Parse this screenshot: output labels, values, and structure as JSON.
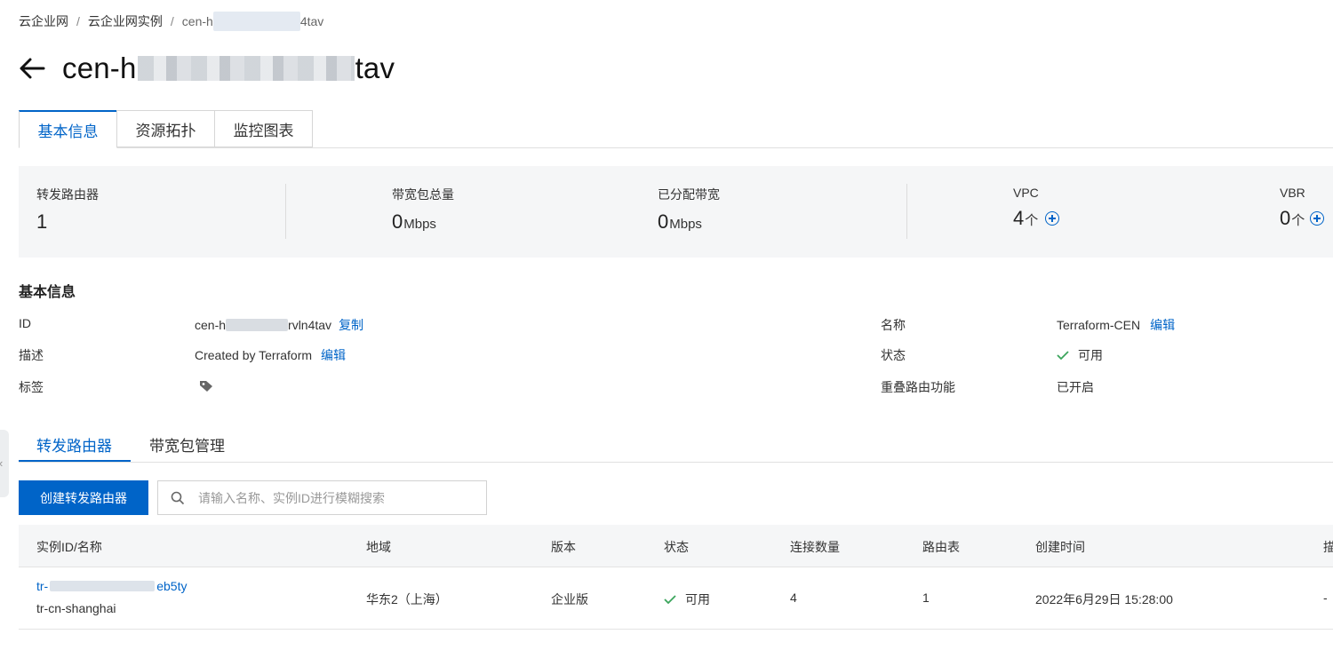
{
  "breadcrumb": {
    "items": [
      "云企业网",
      "云企业网实例"
    ],
    "current_prefix": "cen-h",
    "current_suffix": "4tav",
    "separator": "/"
  },
  "title": {
    "prefix": "cen-h",
    "suffix": "tav"
  },
  "main_tabs": [
    {
      "label": "基本信息",
      "active": true
    },
    {
      "label": "资源拓扑",
      "active": false
    },
    {
      "label": "监控图表",
      "active": false
    }
  ],
  "stats": [
    {
      "label": "转发路由器",
      "value": "1",
      "unit": ""
    },
    {
      "label": "带宽包总量",
      "value": "0",
      "unit": "Mbps"
    },
    {
      "label": "已分配带宽",
      "value": "0",
      "unit": "Mbps"
    },
    {
      "label": "VPC",
      "value": "4",
      "unit": "个"
    },
    {
      "label": "VBR",
      "value": "0",
      "unit": "个"
    }
  ],
  "basic_info": {
    "section_title": "基本信息",
    "id_label": "ID",
    "id_prefix": "cen-h",
    "id_suffix": "rvln4tav",
    "copy_label": "复制",
    "desc_label": "描述",
    "desc_value": "Created by Terraform",
    "edit_label": "编辑",
    "tag_label": "标签",
    "name_label": "名称",
    "name_value": "Terraform-CEN",
    "status_label": "状态",
    "status_value": "可用",
    "overlap_label": "重叠路由功能",
    "overlap_value": "已开启"
  },
  "sub_tabs": [
    {
      "label": "转发路由器",
      "active": true
    },
    {
      "label": "带宽包管理",
      "active": false
    }
  ],
  "toolbar": {
    "create_label": "创建转发路由器",
    "search_placeholder": "请输入名称、实例ID进行模糊搜索"
  },
  "table": {
    "columns": [
      "实例ID/名称",
      "地域",
      "版本",
      "状态",
      "连接数量",
      "路由表",
      "创建时间",
      "描"
    ],
    "rows": [
      {
        "id_prefix": "tr-",
        "id_suffix": "eb5ty",
        "name": "tr-cn-shanghai",
        "region": "华东2（上海）",
        "edition": "企业版",
        "status": "可用",
        "connections": "4",
        "route_tables": "1",
        "created": "2022年6月29日 15:28:00",
        "desc": "-"
      }
    ]
  },
  "colors": {
    "primary": "#0064c8",
    "success": "#3ba55c",
    "panel": "#f5f6f7"
  }
}
